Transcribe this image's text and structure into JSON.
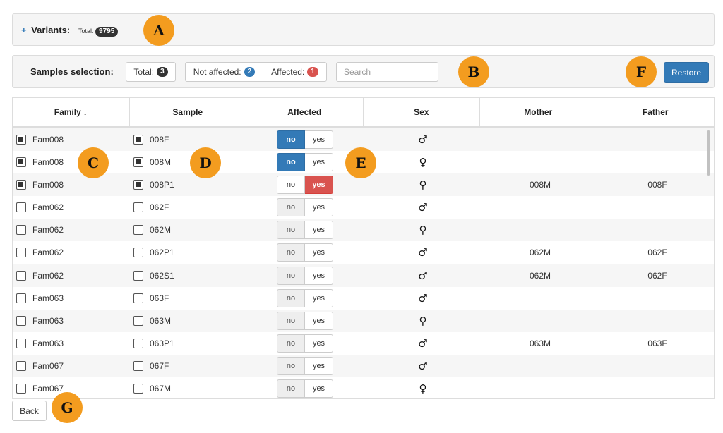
{
  "variants": {
    "toggle_symbol": "+",
    "label": "Variants:",
    "total_label": "Total:",
    "total_count": "9795"
  },
  "samples": {
    "label": "Samples selection:",
    "total_label": "Total:",
    "total_count": "3",
    "not_affected_label": "Not affected:",
    "not_affected_count": "2",
    "affected_label": "Affected:",
    "affected_count": "1",
    "search_placeholder": "Search",
    "restore_label": "Restore"
  },
  "table": {
    "headers": {
      "family": "Family",
      "sort_arrow": "↓",
      "sample": "Sample",
      "affected": "Affected",
      "sex": "Sex",
      "mother": "Mother",
      "father": "Father"
    },
    "toggle_no": "no",
    "toggle_yes": "yes",
    "rows": [
      {
        "family": "Fam008",
        "sample": "008F",
        "checked": true,
        "affected": "no",
        "sex": "♂",
        "mother": "",
        "father": ""
      },
      {
        "family": "Fam008",
        "sample": "008M",
        "checked": true,
        "affected": "no",
        "sex": "♀",
        "mother": "",
        "father": ""
      },
      {
        "family": "Fam008",
        "sample": "008P1",
        "checked": true,
        "affected": "yes",
        "sex": "♀",
        "mother": "008M",
        "father": "008F"
      },
      {
        "family": "Fam062",
        "sample": "062F",
        "checked": false,
        "affected": "none",
        "sex": "♂",
        "mother": "",
        "father": ""
      },
      {
        "family": "Fam062",
        "sample": "062M",
        "checked": false,
        "affected": "none",
        "sex": "♀",
        "mother": "",
        "father": ""
      },
      {
        "family": "Fam062",
        "sample": "062P1",
        "checked": false,
        "affected": "none",
        "sex": "♂",
        "mother": "062M",
        "father": "062F"
      },
      {
        "family": "Fam062",
        "sample": "062S1",
        "checked": false,
        "affected": "none",
        "sex": "♂",
        "mother": "062M",
        "father": "062F"
      },
      {
        "family": "Fam063",
        "sample": "063F",
        "checked": false,
        "affected": "none",
        "sex": "♂",
        "mother": "",
        "father": ""
      },
      {
        "family": "Fam063",
        "sample": "063M",
        "checked": false,
        "affected": "none",
        "sex": "♀",
        "mother": "",
        "father": ""
      },
      {
        "family": "Fam063",
        "sample": "063P1",
        "checked": false,
        "affected": "none",
        "sex": "♂",
        "mother": "063M",
        "father": "063F"
      },
      {
        "family": "Fam067",
        "sample": "067F",
        "checked": false,
        "affected": "none",
        "sex": "♂",
        "mother": "",
        "father": ""
      },
      {
        "family": "Fam067",
        "sample": "067M",
        "checked": false,
        "affected": "none",
        "sex": "♀",
        "mother": "",
        "father": ""
      }
    ]
  },
  "back_label": "Back",
  "markers": [
    "A",
    "B",
    "C",
    "D",
    "E",
    "F",
    "G"
  ],
  "colors": {
    "primary": "#337ab7",
    "danger": "#d9534f",
    "marker": "#f39c1f"
  }
}
